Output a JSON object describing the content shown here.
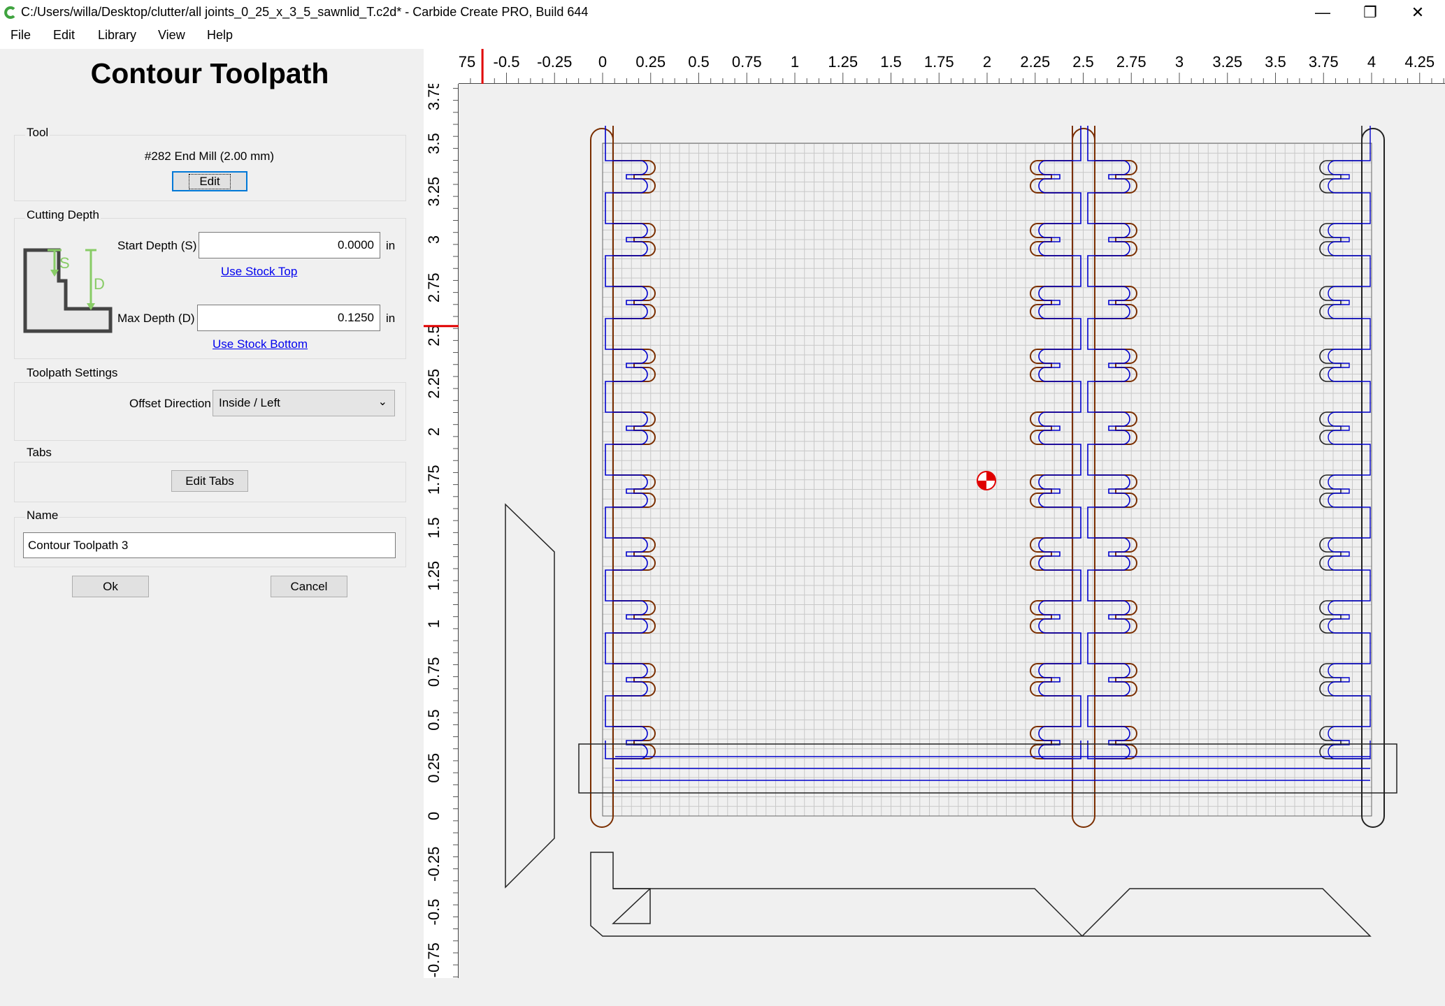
{
  "window": {
    "title": "C:/Users/willa/Desktop/clutter/all joints_0_25_x_3_5_sawnlid_T.c2d* - Carbide Create PRO, Build 644",
    "minimize_icon": "minimize-icon",
    "maximize_icon": "restore-icon",
    "close_icon": "close-icon"
  },
  "menu": {
    "items": [
      {
        "label": "File"
      },
      {
        "label": "Edit"
      },
      {
        "label": "Library"
      },
      {
        "label": "View"
      },
      {
        "label": "Help"
      }
    ]
  },
  "panel": {
    "title": "Contour Toolpath",
    "tool": {
      "group_label": "Tool",
      "name": "#282 End Mill (2.00 mm)",
      "edit_label": "Edit"
    },
    "cutting_depth": {
      "group_label": "Cutting Depth",
      "start_label": "Start Depth (S)",
      "start_value": "0.0000",
      "start_unit": "in",
      "use_stock_top": "Use Stock Top",
      "max_label": "Max Depth (D)",
      "max_value": "0.1250",
      "max_unit": "in",
      "use_stock_bottom": "Use Stock Bottom",
      "diagram_s": "S",
      "diagram_d": "D"
    },
    "toolpath_settings": {
      "group_label": "Toolpath Settings",
      "offset_label": "Offset Direction",
      "offset_value": "Inside / Left"
    },
    "tabs": {
      "group_label": "Tabs",
      "edit_tabs_label": "Edit Tabs"
    },
    "name": {
      "group_label": "Name",
      "value": "Contour Toolpath 3"
    },
    "ok_label": "Ok",
    "cancel_label": "Cancel"
  },
  "rulers": {
    "horizontal_labels": [
      "75",
      "-0.5",
      "-0.25",
      "0",
      "0.25",
      "0.5",
      "0.75",
      "1",
      "1.25",
      "1.5",
      "1.75",
      "2",
      "2.25",
      "2.5",
      "2.75",
      "3",
      "3.25",
      "3.5",
      "3.75",
      "4",
      "4.25"
    ],
    "vertical_labels": [
      "3.75",
      "3.5",
      "3.25",
      "3",
      "2.75",
      "2.5",
      "2.25",
      "2",
      "1.75",
      "1.5",
      "1.25",
      "1",
      "0.75",
      "0.5",
      "0.25",
      "0",
      "-0.25",
      "-0.5",
      "-0.75"
    ],
    "cursor_x": -0.625,
    "cursor_y": 2.55
  },
  "colors": {
    "accent": "#0078d7",
    "toolpath_blue": "#0000cc",
    "contour_brown": "#7a2e00",
    "grid": "#c8c8c8",
    "cursor_red": "#e00000"
  }
}
